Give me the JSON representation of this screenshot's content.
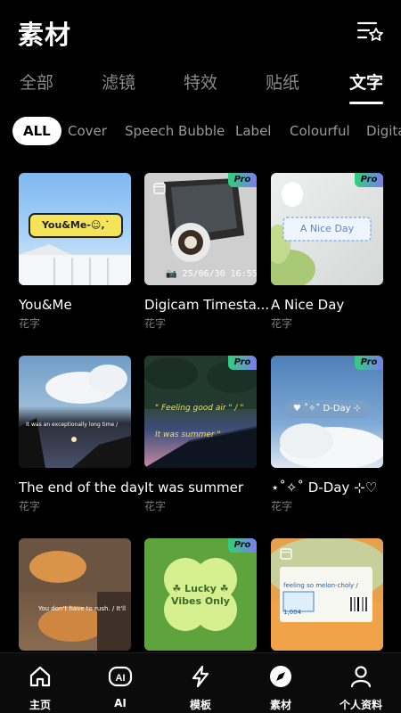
{
  "header": {
    "title": "素材",
    "favorites_icon": "star-list-icon"
  },
  "tabs": [
    {
      "label": "全部",
      "active": false
    },
    {
      "label": "滤镜",
      "active": false
    },
    {
      "label": "特效",
      "active": false
    },
    {
      "label": "贴纸",
      "active": false
    },
    {
      "label": "文字",
      "active": true
    }
  ],
  "chips": [
    {
      "label": "ALL",
      "active": true
    },
    {
      "label": "Cover"
    },
    {
      "label": "Speech Bubble"
    },
    {
      "label": "Label"
    },
    {
      "label": "Colourful"
    },
    {
      "label": "Digita"
    }
  ],
  "cards": [
    {
      "title": "You&Me",
      "subtitle": "花字",
      "pro": false,
      "overlay": "You&Me-☺,˙",
      "badge": ""
    },
    {
      "title": "Digicam Timesta...",
      "subtitle": "花字",
      "pro": true,
      "overlay": "📷 25/06/30  16:55",
      "badge": "Pro"
    },
    {
      "title": "A Nice Day",
      "subtitle": "花字",
      "pro": true,
      "overlay": "A Nice Day",
      "badge": "Pro"
    },
    {
      "title": "The end of the day",
      "subtitle": "花字",
      "pro": false,
      "overlay": "It was an exceptionally long time / The end of the day",
      "badge": ""
    },
    {
      "title": "It was summer",
      "subtitle": "花字",
      "pro": true,
      "overlay": "\" Feeling good air \" / \" It was summer \"",
      "badge": "Pro"
    },
    {
      "title": "⋆˚✧˚ D-Day ⊹♡",
      "subtitle": "花字",
      "pro": true,
      "overlay": "♥ ˚✧˚ D-Day ⊹",
      "badge": "Pro"
    },
    {
      "title": "",
      "subtitle": "",
      "pro": false,
      "overlay": "You don't have to rush. / It'll be okay.",
      "badge": ""
    },
    {
      "title": "",
      "subtitle": "",
      "pro": true,
      "overlay": "☘ Lucky ☘ Vibes Only",
      "badge": "Pro"
    },
    {
      "title": "",
      "subtitle": "",
      "pro": false,
      "overlay": "feeling so melon-choly / 1,004",
      "badge": ""
    }
  ],
  "bottom_nav": [
    {
      "label": "主页",
      "icon": "home-icon"
    },
    {
      "label": "AI",
      "icon": "ai-icon"
    },
    {
      "label": "模板",
      "icon": "lightning-icon"
    },
    {
      "label": "素材",
      "icon": "compass-icon",
      "active": true
    },
    {
      "label": "个人资料",
      "icon": "person-icon"
    }
  ]
}
